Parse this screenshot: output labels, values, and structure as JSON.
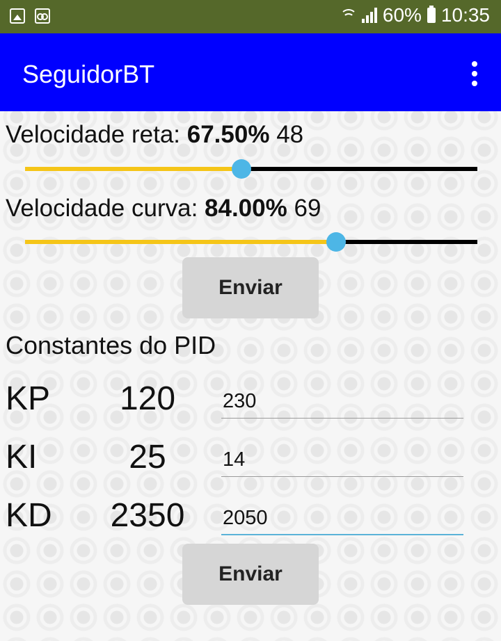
{
  "status_bar": {
    "battery": "60%",
    "time": "10:35"
  },
  "app_bar": {
    "title": "SeguidorBT"
  },
  "speed": {
    "straight": {
      "label": "Velocidade reta:",
      "percent": "67.50%",
      "raw": "48",
      "fraction": 0.4779
    },
    "curve": {
      "label": "Velocidade curva:",
      "percent": "84.00%",
      "raw": "69",
      "fraction": 0.6872
    },
    "send_label": "Enviar"
  },
  "pid": {
    "title": "Constantes do PID",
    "rows": [
      {
        "label": "KP",
        "value": "120",
        "input": "230"
      },
      {
        "label": "KI",
        "value": "25",
        "input": "14"
      },
      {
        "label": "KD",
        "value": "2350",
        "input": "2050"
      }
    ],
    "send_label": "Enviar"
  },
  "colors": {
    "app_bar": "#0000ff",
    "status_bar": "#55682a",
    "slider_fill": "#f5c518",
    "slider_thumb": "#4db6e6"
  }
}
